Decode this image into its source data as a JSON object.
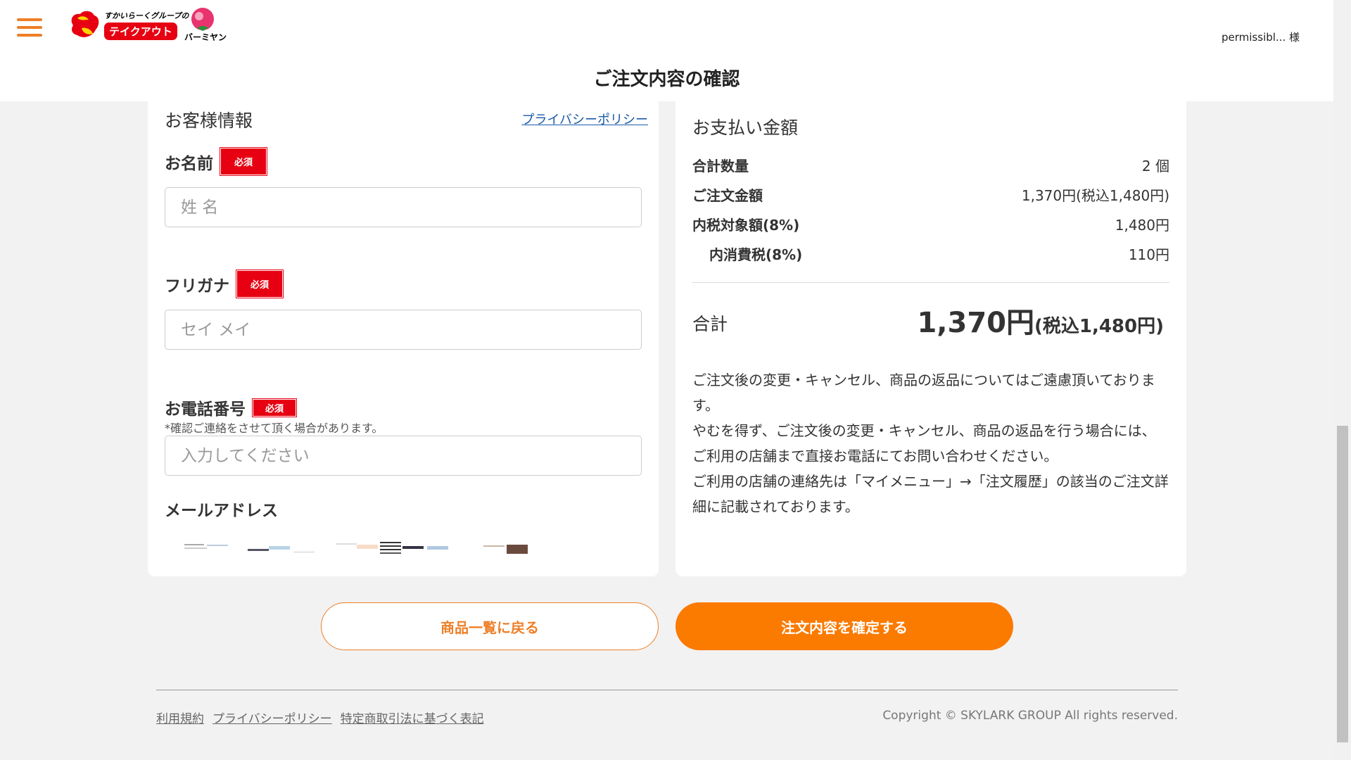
{
  "header": {
    "menu_icon": "hamburger-icon",
    "brand_group_text": "すかいらーくグループの",
    "brand_badge": "テイクアウト",
    "brand2": "バーミヤン",
    "user_name": "permissibl... 様",
    "page_title": "ご注文内容の確認"
  },
  "customer": {
    "heading": "お客様情報",
    "privacy_link": "プライバシーポリシー",
    "required_label": "必須",
    "name_label": "お名前",
    "name_placeholder": "姓 名",
    "kana_label": "フリガナ",
    "kana_placeholder": "セイ メイ",
    "phone_label": "お電話番号",
    "phone_note": "*確認ご連絡をさせて頂く場合があります。",
    "phone_placeholder": "入力してください",
    "email_label": "メールアドレス"
  },
  "payment": {
    "heading": "お支払い金額",
    "rows": [
      {
        "label": "合計数量",
        "value": "2 個"
      },
      {
        "label": "ご注文金額",
        "value": "1,370円(税込1,480円)"
      },
      {
        "label": "内税対象額(8%)",
        "value": "1,480円"
      },
      {
        "label": "内消費税(8%)",
        "value": "110円"
      }
    ],
    "total_label": "合計",
    "total_main": "1,370円",
    "total_tax": "(税込1,480円)",
    "notice_lines": [
      "ご注文後の変更・キャンセル、商品の返品についてはご遠慮頂いております。",
      "やむを得ず、ご注文後の変更・キャンセル、商品の返品を行う場合には、ご利用の店舗まで直接お電話にてお問い合わせください。",
      "ご利用の店舗の連絡先は「マイメニュー」→「注文履歴」の該当のご注文詳細に記載されております。"
    ]
  },
  "buttons": {
    "back": "商品一覧に戻る",
    "confirm": "注文内容を確定する"
  },
  "footer": {
    "links": [
      "利用規約",
      "プライバシーポリシー",
      "特定商取引法に基づく表記"
    ],
    "copyright": "Copyright © SKYLARK GROUP All rights reserved."
  },
  "colors": {
    "accent": "#ee7f27",
    "confirm": "#fb7a00",
    "required": "#e60012",
    "link": "#1a5aa8"
  }
}
